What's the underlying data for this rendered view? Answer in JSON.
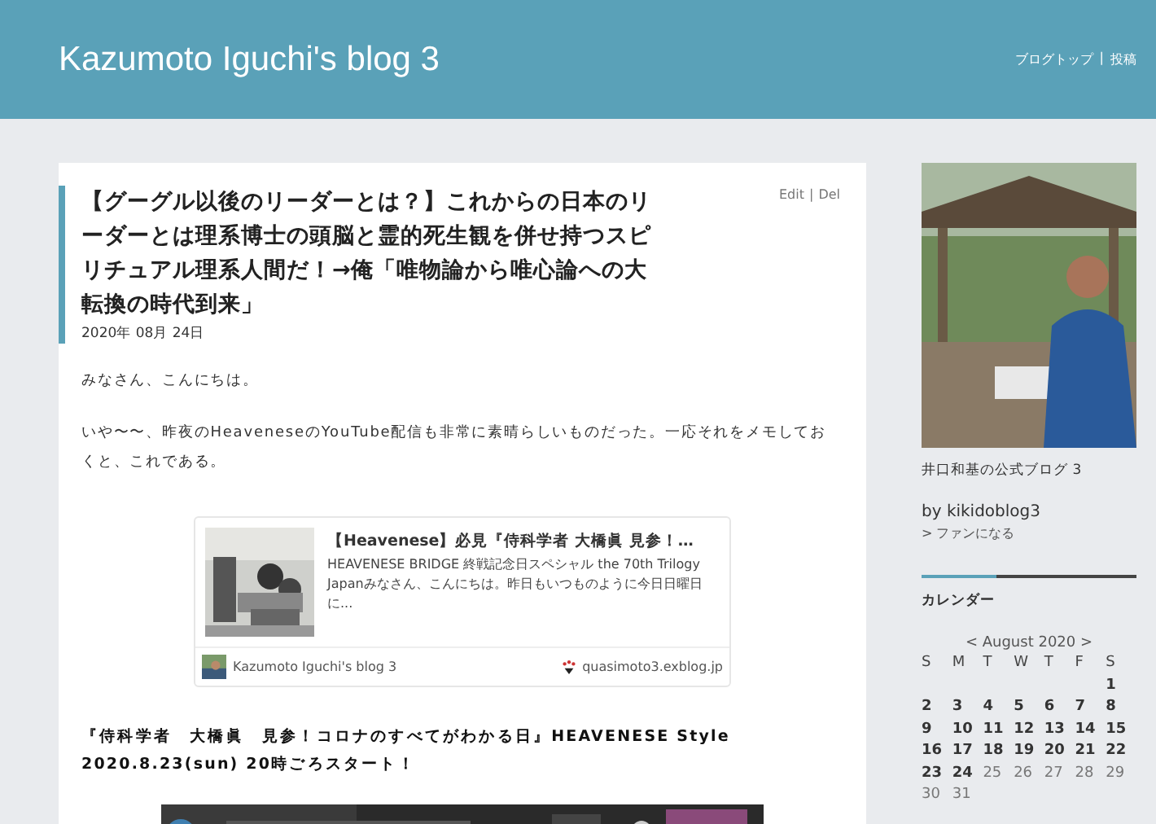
{
  "header": {
    "title": "Kazumoto Iguchi's blog 3",
    "links": [
      "ブログトップ",
      "投稿"
    ],
    "separator": "|"
  },
  "post": {
    "title": "【グーグル以後のリーダーとは？】これからの日本のリーダーとは理系博士の頭脳と霊的死生観を併せ持つスピリチュアル理系人間だ！→俺「唯物論から唯心論への大転換の時代到来」",
    "actions": [
      "Edit",
      "Del"
    ],
    "separator": "|",
    "date": "2020年 08月 24日",
    "paragraphs": [
      "みなさん、こんにちは。",
      "いや〜〜、昨夜のHeaveneseのYouTube配信も非常に素晴らしいものだった。一応それをメモしておくと、これである。"
    ],
    "embed": {
      "title": "【Heavenese】必見『侍科学者 大橋眞 見参！…",
      "excerpt": "HEAVENESE BRIDGE 終戦記念日スペシャル the 70th Trilogy Japanみなさん、こんにちは。昨日もいつものように今日日曜日に...",
      "blog": "Kazumoto Iguchi's blog 3",
      "domain": "quasimoto3.exblog.jp"
    },
    "headline": "『侍科学者　大橋眞　見参！コロナのすべてがわかる日』HEAVENESE Style 2020.8.23(sun) 20時ごろスタート！"
  },
  "sidebar": {
    "caption": "井口和基の公式ブログ 3",
    "author": "by kikidoblog3",
    "fan_link": "> ファンになる",
    "calendar": {
      "heading": "カレンダー",
      "month": "< August 2020 >",
      "weekdays": [
        "S",
        "M",
        "T",
        "W",
        "T",
        "F",
        "S"
      ],
      "weeks": [
        [
          {
            "day": "1",
            "linked": true
          }
        ],
        [
          {
            "day": "2",
            "linked": true
          },
          {
            "day": "3",
            "linked": true
          },
          {
            "day": "4",
            "linked": true
          },
          {
            "day": "5",
            "linked": true
          },
          {
            "day": "6",
            "linked": true
          },
          {
            "day": "7",
            "linked": true
          },
          {
            "day": "8",
            "linked": true
          }
        ],
        [
          {
            "day": "9",
            "linked": true
          },
          {
            "day": "10",
            "linked": true
          },
          {
            "day": "11",
            "linked": true
          },
          {
            "day": "12",
            "linked": true
          },
          {
            "day": "13",
            "linked": true
          },
          {
            "day": "14",
            "linked": true
          },
          {
            "day": "15",
            "linked": true
          }
        ],
        [
          {
            "day": "16",
            "linked": true
          },
          {
            "day": "17",
            "linked": true
          },
          {
            "day": "18",
            "linked": true
          },
          {
            "day": "19",
            "linked": true
          },
          {
            "day": "20",
            "linked": true
          },
          {
            "day": "21",
            "linked": true
          },
          {
            "day": "22",
            "linked": true
          }
        ],
        [
          {
            "day": "23",
            "linked": true
          },
          {
            "day": "24",
            "linked": true
          },
          {
            "day": "25",
            "linked": false
          },
          {
            "day": "26",
            "linked": false
          },
          {
            "day": "27",
            "linked": false
          },
          {
            "day": "28",
            "linked": false
          },
          {
            "day": "29",
            "linked": false
          }
        ],
        [
          {
            "day": "30",
            "linked": false
          },
          {
            "day": "31",
            "linked": false
          }
        ]
      ]
    }
  }
}
